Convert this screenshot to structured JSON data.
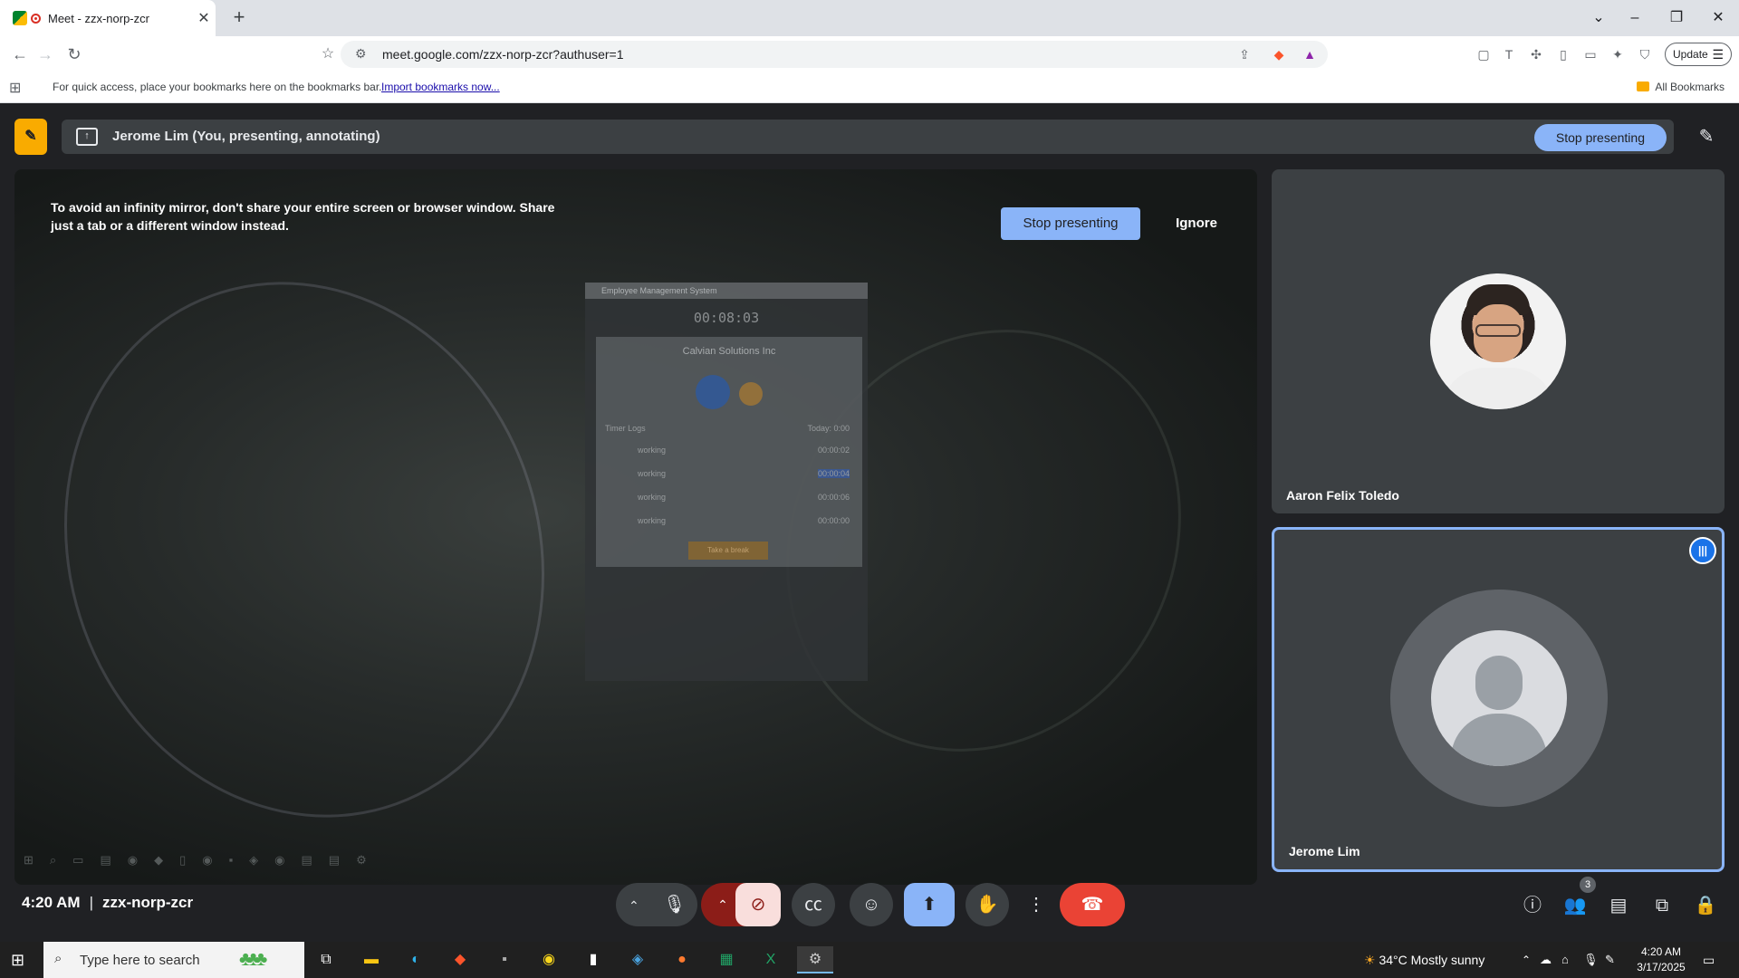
{
  "browser": {
    "tab_title": "Meet - zzx-norp-zcr",
    "url": "meet.google.com/zzx-norp-zcr?authuser=1",
    "update_label": "Update",
    "bookmarks_hint": "For quick access, place your bookmarks here on the bookmarks bar.",
    "import_link": "Import bookmarks now...",
    "all_bookmarks": "All Bookmarks"
  },
  "meet": {
    "presenting_label": "Jerome Lim (You, presenting, annotating)",
    "stop_presenting": "Stop presenting",
    "warning_text": "To avoid an infinity mirror, don't share your entire screen or browser window. Share just a tab or a different window instead.",
    "warning_stop": "Stop presenting",
    "warning_ignore": "Ignore",
    "shared_window": {
      "title": "Employee Management System",
      "timer": "00:08:03",
      "company": "Calvian Solutions Inc",
      "logs_label": "Timer Logs",
      "today_label": "Today: 0:00",
      "rows": [
        {
          "status": "working",
          "time": "00:00:02"
        },
        {
          "status": "working",
          "time": "00:00:04"
        },
        {
          "status": "working",
          "time": "00:00:06"
        },
        {
          "status": "working",
          "time": "00:00:00"
        }
      ],
      "button": "Take a break"
    },
    "participants": [
      {
        "name": "Aaron Felix Toledo"
      },
      {
        "name": "Jerome Lim"
      }
    ],
    "time": "4:20 AM",
    "meeting_code": "zzx-norp-zcr",
    "participant_count": "3"
  },
  "taskbar": {
    "search_placeholder": "Type here to search",
    "weather": "34°C  Mostly sunny",
    "time": "4:20 AM",
    "date": "3/17/2025"
  },
  "colors": {
    "meet_bg": "#202124",
    "accent_blue": "#8ab4f8",
    "end_call_red": "#ea4335",
    "annotate_yellow": "#f9ab00"
  }
}
